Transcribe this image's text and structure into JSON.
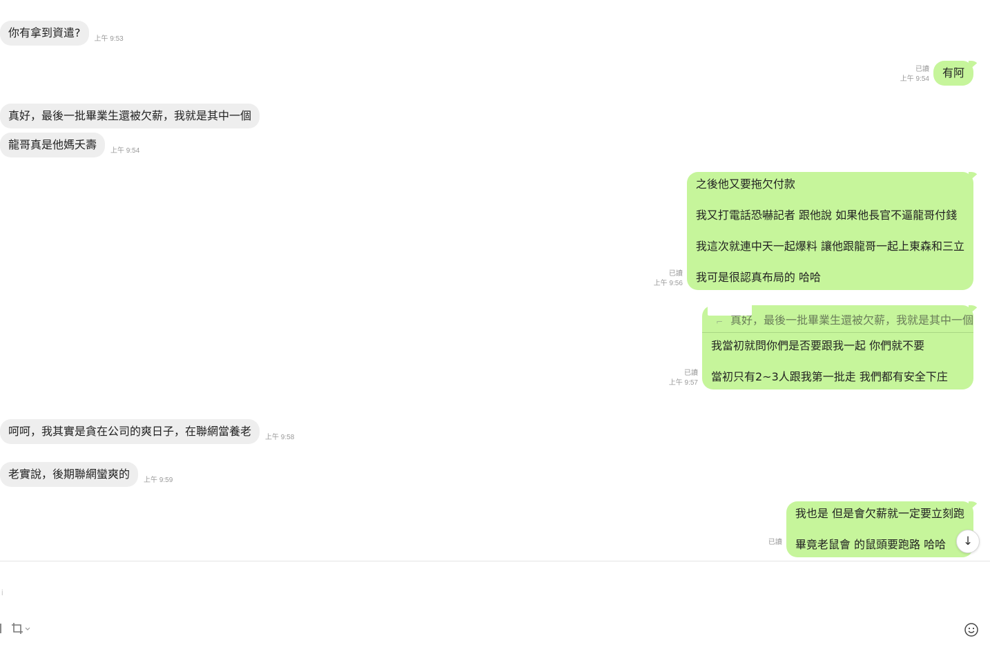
{
  "messages": [
    {
      "id": 1,
      "dir": "in",
      "text": "你有拿到資遣?",
      "time": "上午 9:53"
    },
    {
      "id": 2,
      "dir": "out",
      "text": "有阿",
      "read": "已讀",
      "time": "上午 9:54"
    },
    {
      "id": 3,
      "dir": "in",
      "text": "真好，最後一批畢業生還被欠薪，我就是其中一個"
    },
    {
      "id": 4,
      "dir": "in",
      "text": "龍哥真是他媽夭壽",
      "time": "上午 9:54"
    },
    {
      "id": 5,
      "dir": "out",
      "lines": [
        "之後他又要拖欠付款",
        "我又打電話恐嚇記者 跟他說 如果他長官不逼龍哥付錢",
        "我這次就連中天一起爆料 讓他跟龍哥一起上東森和三立",
        "我可是很認真布局的 哈哈"
      ],
      "read": "已讀",
      "time": "上午 9:56"
    },
    {
      "id": 6,
      "dir": "out",
      "reply_to": "真好，最後一批畢業生還被欠薪，我就是其中一個",
      "lines": [
        "我當初就問你們是否要跟我一起 你們就不要",
        "當初只有2~3人跟我第一批走 我們都有安全下庄"
      ],
      "read": "已讀",
      "time": "上午 9:57"
    },
    {
      "id": 7,
      "dir": "in",
      "text": "呵呵，我其實是貪在公司的爽日子，在聯網當養老",
      "time": "上午 9:58"
    },
    {
      "id": 8,
      "dir": "in",
      "text": "老實說，後期聯網蠻爽的",
      "time": "上午 9:59"
    },
    {
      "id": 9,
      "dir": "out",
      "lines": [
        "我也是 但是會欠薪就一定要立刻跑",
        "畢竟老鼠會 的鼠頭要跑路 哈哈"
      ],
      "read": "已讀"
    }
  ],
  "input": {
    "placeholder": "i",
    "value": ""
  },
  "icons": {
    "scroll_down": "↓",
    "crop": "crop-icon",
    "emoji": "emoji-icon"
  },
  "colors": {
    "incoming_bubble": "#eeeeee",
    "outgoing_bubble": "#c6f59b",
    "meta_text": "#999999"
  }
}
